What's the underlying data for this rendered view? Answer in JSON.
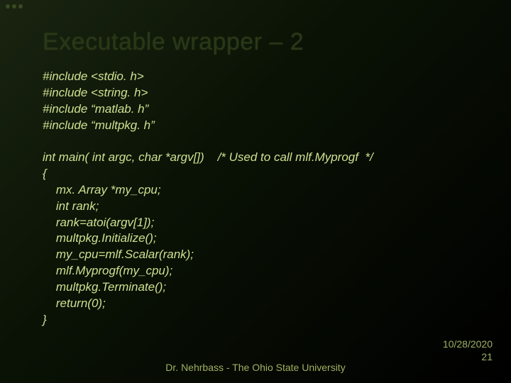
{
  "title": "Executable wrapper – 2",
  "includes": [
    "#include <stdio. h>",
    "#include <string. h>",
    "#include “matlab. h”",
    "#include “multpkg. h”"
  ],
  "main_sig": "int main( int argc, char *argv[])    /* Used to call mlf.Myprogf  */",
  "body": [
    "{",
    "    mx. Array *my_cpu;",
    "    int rank;",
    "    rank=atoi(argv[1]);",
    "    multpkg.Initialize();",
    "    my_cpu=mlf.Scalar(rank);",
    "    mlf.Myprogf(my_cpu);",
    "    multpkg.Terminate();",
    "    return(0);",
    "}"
  ],
  "footer": "Dr. Nehrbass - The Ohio State University",
  "date": "10/28/2020",
  "page": "21"
}
